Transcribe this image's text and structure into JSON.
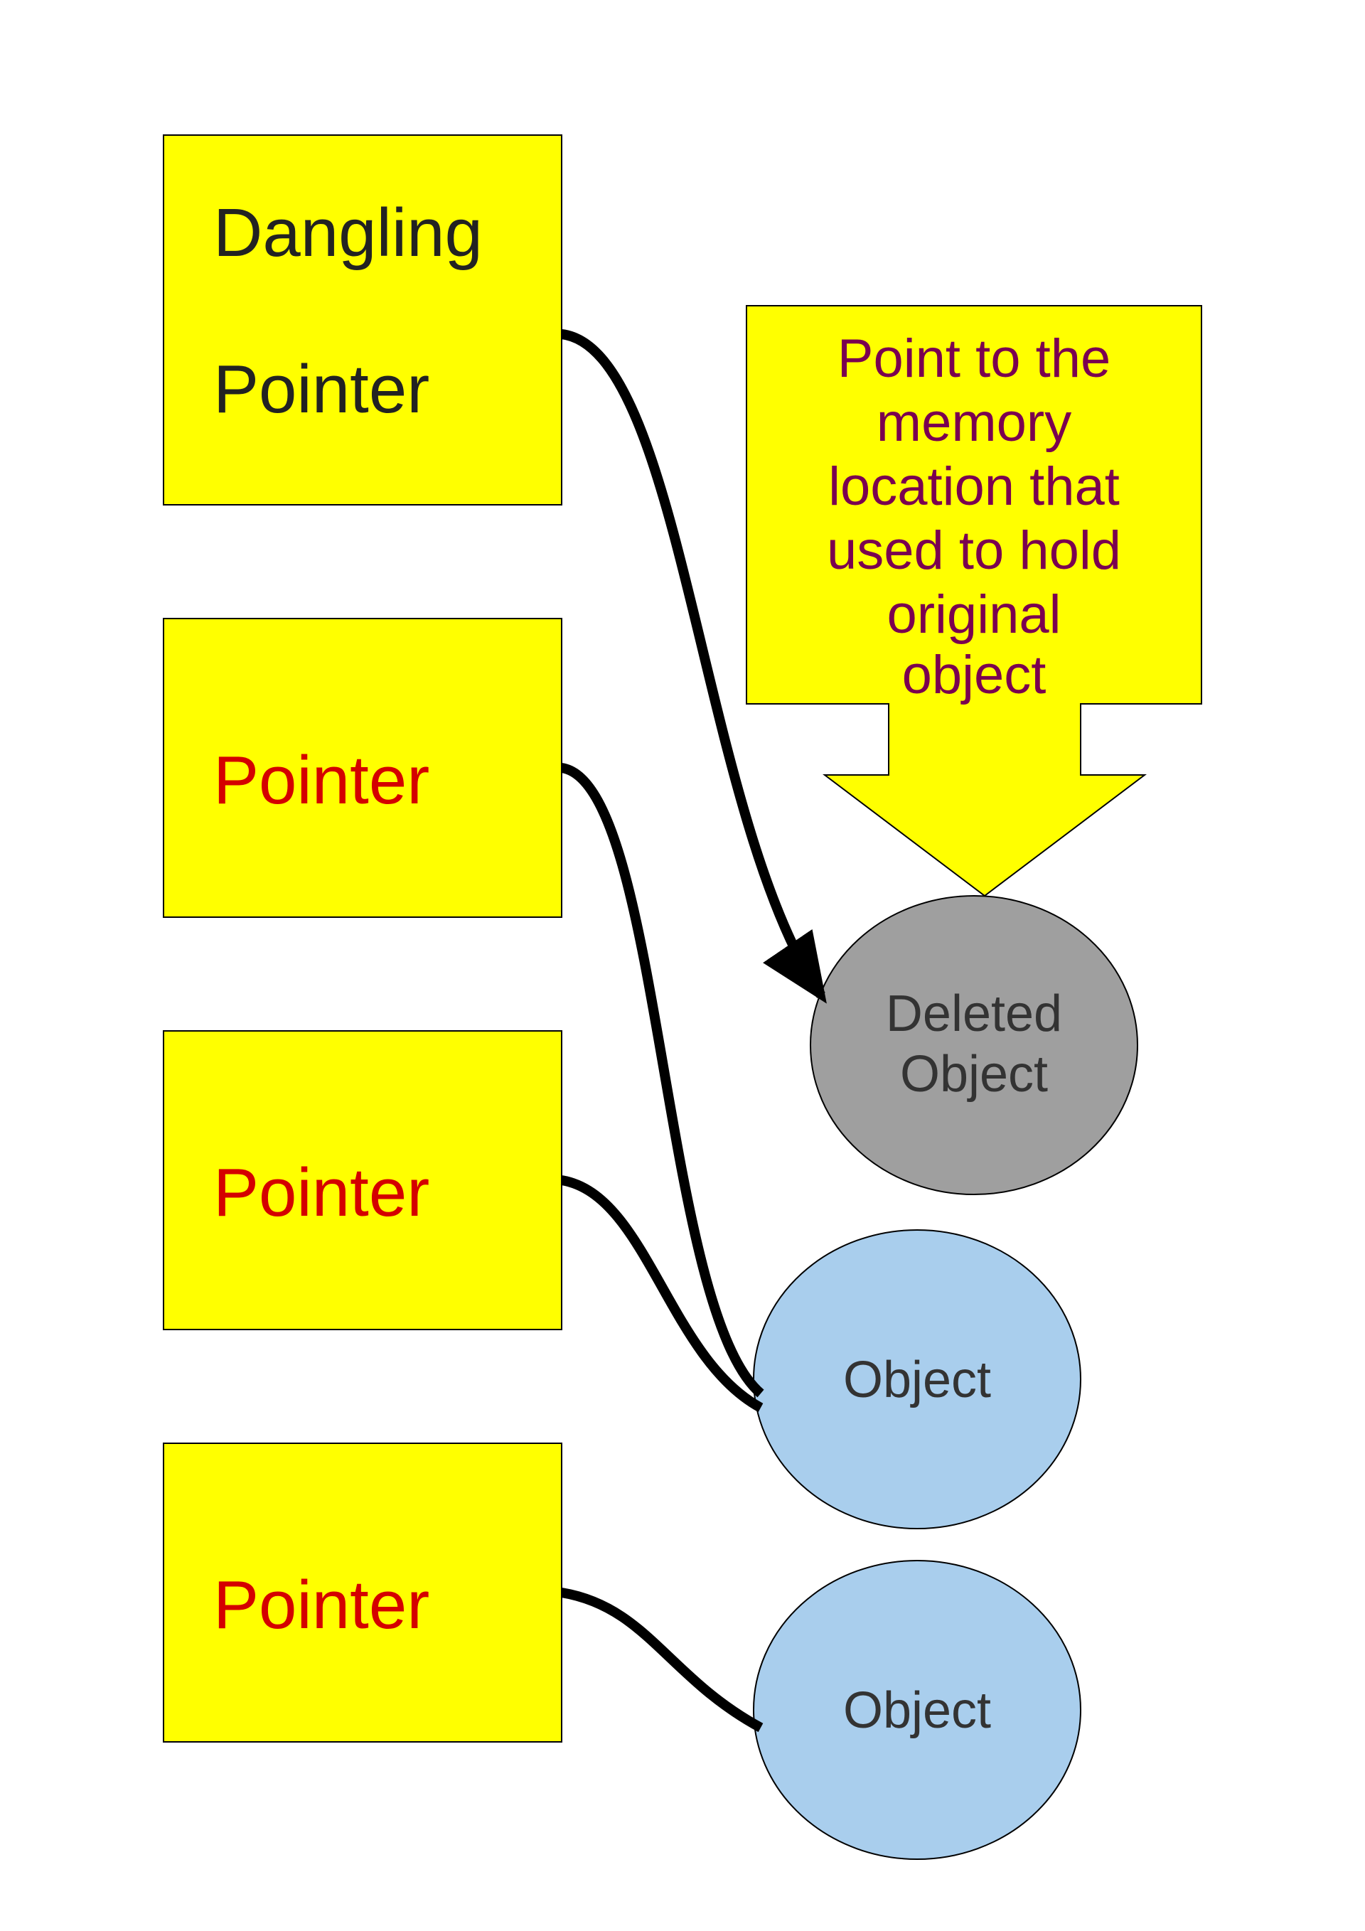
{
  "boxes": {
    "dangling": {
      "line1": "Dangling",
      "line2": "Pointer"
    },
    "p1": "Pointer",
    "p2": "Pointer",
    "p3": "Pointer"
  },
  "callout": {
    "l1": "Point to the",
    "l2": "memory",
    "l3": "location that",
    "l4": "used to hold",
    "l5": "original",
    "l6": "object"
  },
  "ellipses": {
    "deleted": {
      "l1": "Deleted",
      "l2": "Object"
    },
    "obj1": "Object",
    "obj2": "Object"
  },
  "colors": {
    "yellow": "#ffff00",
    "blue": "#a9ceed",
    "grey": "#9f9f9f",
    "stroke": "#000000",
    "arrow": "#000000"
  }
}
